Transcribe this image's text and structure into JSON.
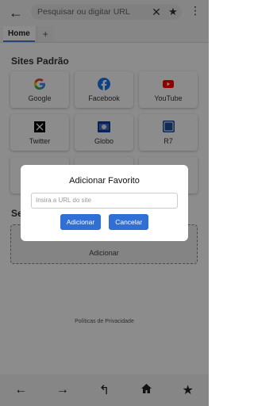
{
  "address_bar": {
    "placeholder": "Pesquisar ou digitar URL",
    "back_icon": "←",
    "clear_icon": "✕",
    "star_icon": "★",
    "menu_icon": "⋮"
  },
  "tabs": {
    "items": [
      {
        "label": "Home"
      }
    ],
    "add_label": "+"
  },
  "default_sites": {
    "title": "Sites Padrão",
    "items": [
      {
        "label": "Google",
        "icon": "google-icon"
      },
      {
        "label": "Facebook",
        "icon": "facebook-icon"
      },
      {
        "label": "YouTube",
        "icon": "youtube-icon"
      },
      {
        "label": "Twitter",
        "icon": "x-icon"
      },
      {
        "label": "Globo",
        "icon": "globo-icon"
      },
      {
        "label": "R7",
        "icon": "r7-icon"
      }
    ]
  },
  "saved_section": {
    "title_partial": "Se",
    "add_label": "Adicionar"
  },
  "privacy_link": "Políticas de Privacidade",
  "bottom_nav": {
    "back": "←",
    "forward": "→",
    "reload": "↰",
    "home": "⌂",
    "favorites": "★"
  },
  "dialog": {
    "title": "Adicionar Favorito",
    "input_placeholder": "Insira a URL do site",
    "add_button": "Adicionar",
    "cancel_button": "Cancelar"
  },
  "colors": {
    "accent": "#2f6fd6",
    "overlay": "rgba(0,0,0,0.45)"
  }
}
